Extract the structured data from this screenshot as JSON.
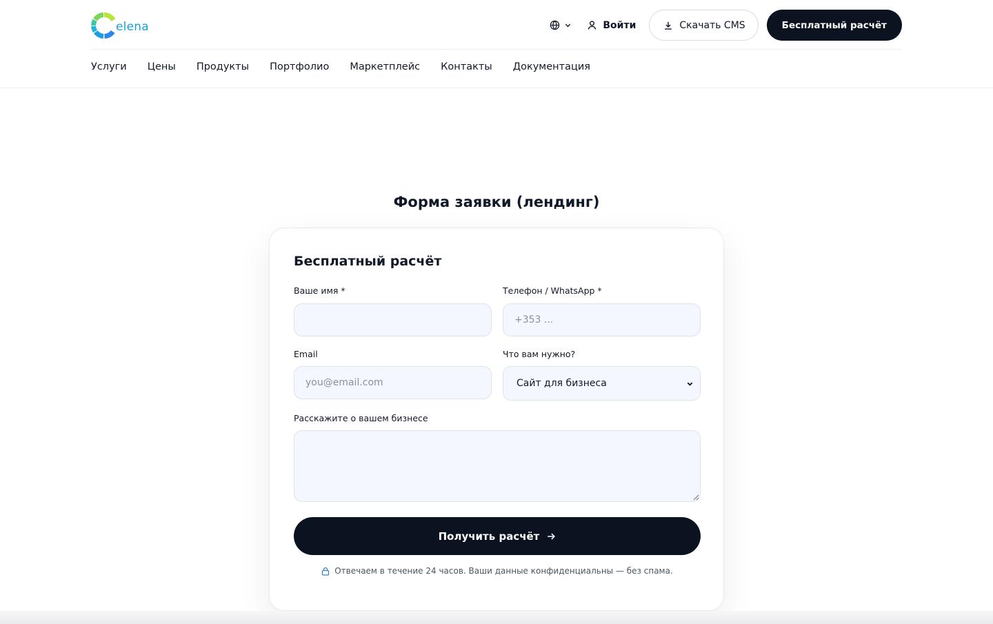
{
  "header": {
    "logo": {
      "text": "elena"
    },
    "lang": {
      "icon": "globe-icon",
      "chevron": "chevron-down-icon"
    },
    "login_label": "Войти",
    "download_label": "Скачать CMS",
    "cta_label": "Бесплатный расчёт",
    "nav": [
      "Услуги",
      "Цены",
      "Продукты",
      "Портфолио",
      "Маркетплейс",
      "Контакты",
      "Документация"
    ]
  },
  "section": {
    "title": "Форма заявки (лендинг)"
  },
  "form": {
    "title": "Бесплатный расчёт",
    "name": {
      "label": "Ваше имя *",
      "value": "",
      "placeholder": ""
    },
    "phone": {
      "label": "Телефон / WhatsApp *",
      "value": "",
      "placeholder": "+353 ..."
    },
    "email": {
      "label": "Email",
      "value": "",
      "placeholder": "you@email.com"
    },
    "need": {
      "label": "Что вам нужно?",
      "selected": "Сайт для бизнеса"
    },
    "about": {
      "label": "Расскажите о вашем бизнесе",
      "value": ""
    },
    "submit_label": "Получить расчёт",
    "note": "Отвечаем в течение 24 часов. Ваши данные конфиденциальны — без спама."
  },
  "colors": {
    "primary_dark": "#0b1220",
    "field_bg": "#f4f7fd",
    "logo_blue": "#1aa0d8",
    "logo_green": "#8fd14f"
  }
}
